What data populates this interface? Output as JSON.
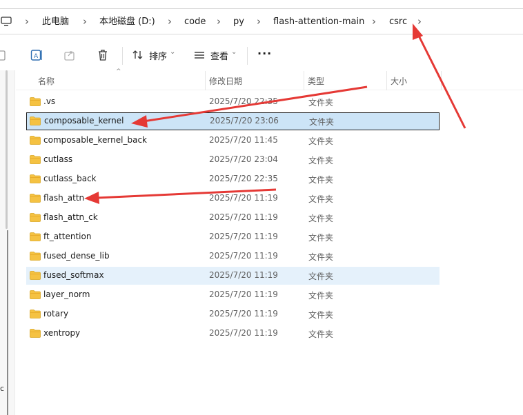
{
  "breadcrumb": {
    "items": [
      "此电脑",
      "本地磁盘 (D:)",
      "code",
      "py",
      "flash-attention-main",
      "csrc"
    ]
  },
  "toolbar": {
    "sort_label": "排序",
    "view_label": "查看",
    "more_label": "···"
  },
  "columns": {
    "name": "名称",
    "date": "修改日期",
    "type": "类型",
    "size": "大小"
  },
  "files": [
    {
      "name": ".vs",
      "date": "2025/7/20 22:35",
      "type": "文件夹"
    },
    {
      "name": "composable_kernel",
      "date": "2025/7/20 23:06",
      "type": "文件夹",
      "state": "selected"
    },
    {
      "name": "composable_kernel_back",
      "date": "2025/7/20 11:45",
      "type": "文件夹"
    },
    {
      "name": "cutlass",
      "date": "2025/7/20 23:04",
      "type": "文件夹"
    },
    {
      "name": "cutlass_back",
      "date": "2025/7/20 22:35",
      "type": "文件夹"
    },
    {
      "name": "flash_attn",
      "date": "2025/7/20 11:19",
      "type": "文件夹"
    },
    {
      "name": "flash_attn_ck",
      "date": "2025/7/20 11:19",
      "type": "文件夹"
    },
    {
      "name": "ft_attention",
      "date": "2025/7/20 11:19",
      "type": "文件夹"
    },
    {
      "name": "fused_dense_lib",
      "date": "2025/7/20 11:19",
      "type": "文件夹"
    },
    {
      "name": "fused_softmax",
      "date": "2025/7/20 11:19",
      "type": "文件夹",
      "state": "hover"
    },
    {
      "name": "layer_norm",
      "date": "2025/7/20 11:19",
      "type": "文件夹"
    },
    {
      "name": "rotary",
      "date": "2025/7/20 11:19",
      "type": "文件夹"
    },
    {
      "name": "xentropy",
      "date": "2025/7/20 11:19",
      "type": "文件夹"
    }
  ],
  "leftnav": {
    "partial_text": "c"
  },
  "colors": {
    "selected_bg": "#cce4f7",
    "hover_bg": "#e5f1fb",
    "folder": "#f5c242",
    "annotation_arrow": "#e53935"
  }
}
